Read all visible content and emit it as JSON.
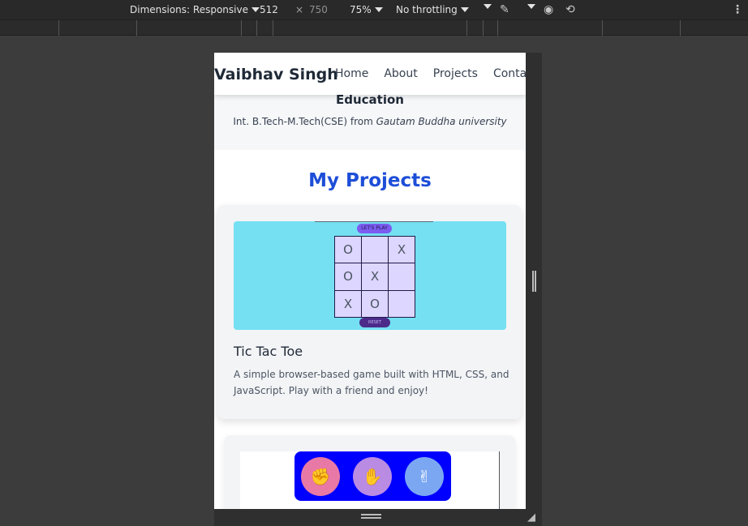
{
  "devtools": {
    "dimensions_label": "Dimensions: Responsive",
    "width": "512",
    "times": "×",
    "height": "750",
    "zoom": "75%",
    "throttling": "No throttling"
  },
  "nav": {
    "brand": "Vaibhav Singh",
    "links": [
      "Home",
      "About",
      "Projects",
      "Contact"
    ]
  },
  "education": {
    "title": "Education",
    "degree": "Int. B.Tech-M.Tech(CSE) from ",
    "university": "Gautam Buddha university"
  },
  "projects": {
    "heading": "My Projects",
    "items": [
      {
        "title": "Tic Tac Toe",
        "description": "A simple browser-based game built with HTML, CSS, and JavaScript. Play with a friend and enjoy!",
        "preview": {
          "top_button": "LET'S PLAY",
          "bottom_button": "RESET",
          "cells": [
            "O",
            "",
            "X",
            "O",
            "X",
            "",
            "X",
            "O",
            ""
          ]
        }
      },
      {
        "preview": {
          "choices": [
            "rock-hand-icon",
            "paper-hand-icon",
            "scissors-hand-icon"
          ],
          "colors": [
            "#e879a6",
            "#b98be3",
            "#7ba7f2"
          ],
          "glyphs": [
            "✊",
            "✋",
            "✌"
          ]
        }
      }
    ]
  }
}
